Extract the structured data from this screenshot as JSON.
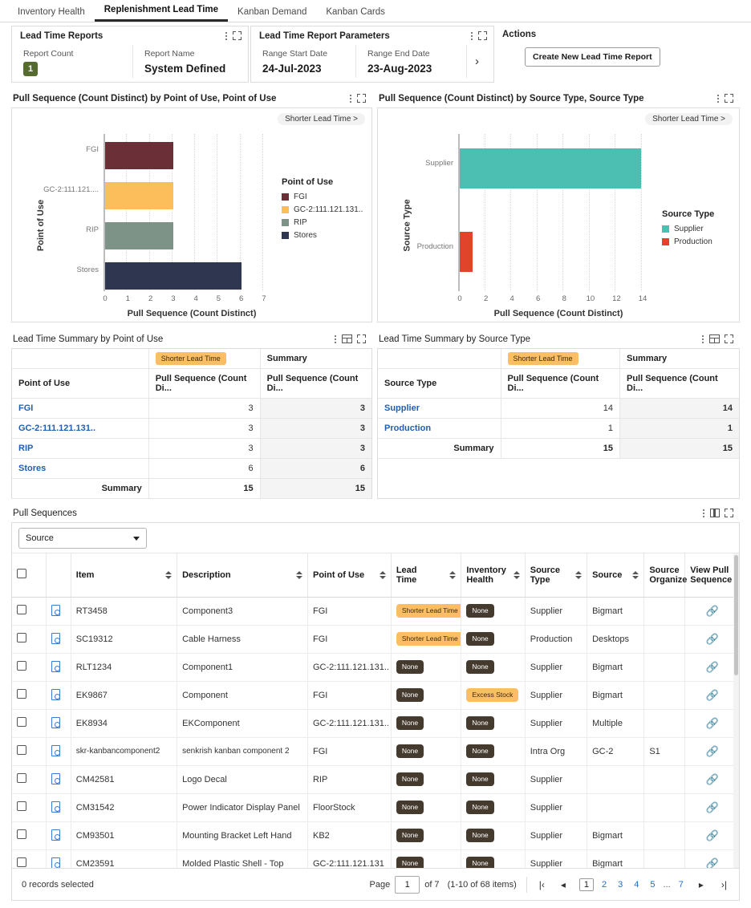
{
  "tabs": [
    {
      "label": "Inventory Health",
      "active": false
    },
    {
      "label": "Replenishment Lead Time",
      "active": true
    },
    {
      "label": "Kanban Demand",
      "active": false
    },
    {
      "label": "Kanban Cards",
      "active": false
    }
  ],
  "reports_panel": {
    "title": "Lead Time Reports",
    "report_count_label": "Report Count",
    "report_count_value": "1",
    "report_name_label": "Report Name",
    "report_name_value": "System Defined"
  },
  "params_panel": {
    "title": "Lead Time Report Parameters",
    "range_start_label": "Range Start Date",
    "range_start_value": "24-Jul-2023",
    "range_end_label": "Range End Date",
    "range_end_value": "23-Aug-2023",
    "next_chevron": "›"
  },
  "actions_panel": {
    "title": "Actions",
    "create_button": "Create New Lead Time Report"
  },
  "chart_left": {
    "title": "Pull Sequence (Count Distinct) by Point of Use, Point of Use",
    "filter_pill": "Shorter Lead Time >",
    "legend_title": "Point of Use",
    "legend": [
      {
        "label": "FGI",
        "color": "#6B2F38"
      },
      {
        "label": "GC-2:111.121.131..",
        "color": "#FBBE5B"
      },
      {
        "label": "RIP",
        "color": "#7E9387"
      },
      {
        "label": "Stores",
        "color": "#2F3650"
      }
    ]
  },
  "chart_right": {
    "title": "Pull Sequence (Count Distinct) by Source Type, Source Type",
    "filter_pill": "Shorter Lead Time >",
    "legend_title": "Source Type",
    "legend": [
      {
        "label": "Supplier",
        "color": "#4DBFB2"
      },
      {
        "label": "Production",
        "color": "#E0442A"
      }
    ]
  },
  "chart_data": [
    {
      "type": "bar",
      "orientation": "horizontal",
      "title": "Pull Sequence (Count Distinct) by Point of Use, Point of Use",
      "categories": [
        "FGI",
        "GC-2:111.121....",
        "RIP",
        "Stores"
      ],
      "values": [
        3,
        3,
        3,
        6
      ],
      "colors": [
        "#6B2F38",
        "#FBBE5B",
        "#7E9387",
        "#2F3650"
      ],
      "xlabel": "Pull Sequence (Count Distinct)",
      "ylabel": "Point of Use",
      "xticks": [
        0,
        1,
        2,
        3,
        4,
        5,
        6,
        7
      ],
      "xlim": [
        0,
        7
      ],
      "grid": true,
      "legend_position": "right",
      "legend_title": "Point of Use",
      "legend_entries": [
        "FGI",
        "GC-2:111.121.131..",
        "RIP",
        "Stores"
      ],
      "annotations": [
        "Shorter Lead Time >"
      ]
    },
    {
      "type": "bar",
      "orientation": "horizontal",
      "title": "Pull Sequence (Count Distinct) by Source Type, Source Type",
      "categories": [
        "Supplier",
        "Production"
      ],
      "values": [
        14,
        1
      ],
      "colors": [
        "#4DBFB2",
        "#E0442A"
      ],
      "xlabel": "Pull Sequence (Count Distinct)",
      "ylabel": "Source Type",
      "xticks": [
        0,
        2,
        4,
        6,
        8,
        10,
        12,
        14
      ],
      "xlim": [
        0,
        14
      ],
      "grid": true,
      "legend_position": "right",
      "legend_title": "Source Type",
      "legend_entries": [
        "Supplier",
        "Production"
      ],
      "annotations": [
        "Shorter Lead Time >"
      ]
    }
  ],
  "summary_left": {
    "title": "Lead Time Summary by Point of Use",
    "tag": "Shorter Lead Time",
    "summary_header": "Summary",
    "col_dim": "Point of Use",
    "col_metric_1": "Pull Sequence (Count Di...",
    "col_metric_2": "Pull Sequence (Count Di...",
    "rows": [
      {
        "dim": "FGI",
        "m1": "3",
        "m2": "3"
      },
      {
        "dim": "GC-2:111.121.131..",
        "m1": "3",
        "m2": "3"
      },
      {
        "dim": "RIP",
        "m1": "3",
        "m2": "3"
      },
      {
        "dim": "Stores",
        "m1": "6",
        "m2": "6"
      }
    ],
    "total_label": "Summary",
    "total_m1": "15",
    "total_m2": "15"
  },
  "summary_right": {
    "title": "Lead Time Summary by Source Type",
    "tag": "Shorter Lead Time",
    "summary_header": "Summary",
    "col_dim": "Source Type",
    "col_metric_1": "Pull Sequence (Count Di...",
    "col_metric_2": "Pull Sequence (Count Di...",
    "rows": [
      {
        "dim": "Supplier",
        "m1": "14",
        "m2": "14"
      },
      {
        "dim": "Production",
        "m1": "1",
        "m2": "1"
      }
    ],
    "total_label": "Summary",
    "total_m1": "15",
    "total_m2": "15"
  },
  "pull_sequences": {
    "title": "Pull Sequences",
    "filter_select_value": "Source",
    "columns": [
      {
        "label": "",
        "sortable": false
      },
      {
        "label": "",
        "sortable": false
      },
      {
        "label": "Item",
        "sortable": true
      },
      {
        "label": "Description",
        "sortable": true
      },
      {
        "label": "Point of Use",
        "sortable": true
      },
      {
        "label": "Lead Time",
        "sortable": true
      },
      {
        "label": "Inventory Health",
        "sortable": true
      },
      {
        "label": "Source Type",
        "sortable": true
      },
      {
        "label": "Source",
        "sortable": true
      },
      {
        "label": "Source Organize",
        "sortable": false
      },
      {
        "label": "View Pull Sequence",
        "sortable": false
      }
    ],
    "rows": [
      {
        "item": "RT3458",
        "description": "Component3",
        "point_of_use": "FGI",
        "lead_time": "Shorter Lead Time",
        "lead_time_style": "amber",
        "inventory_health": "None",
        "inventory_health_style": "none",
        "source_type": "Supplier",
        "source": "Bigmart",
        "source_org": ""
      },
      {
        "item": "SC19312",
        "description": "Cable Harness",
        "point_of_use": "FGI",
        "lead_time": "Shorter Lead Time",
        "lead_time_style": "amber",
        "inventory_health": "None",
        "inventory_health_style": "none",
        "source_type": "Production",
        "source": "Desktops",
        "source_org": ""
      },
      {
        "item": "RLT1234",
        "description": "Component1",
        "point_of_use": "GC-2:111.121.131..",
        "lead_time": "None",
        "lead_time_style": "none",
        "inventory_health": "None",
        "inventory_health_style": "none",
        "source_type": "Supplier",
        "source": "Bigmart",
        "source_org": ""
      },
      {
        "item": "EK9867",
        "description": "Component",
        "point_of_use": "FGI",
        "lead_time": "None",
        "lead_time_style": "none",
        "inventory_health": "Excess Stock",
        "inventory_health_style": "amber",
        "source_type": "Supplier",
        "source": "Bigmart",
        "source_org": ""
      },
      {
        "item": "EK8934",
        "description": "EKComponent",
        "point_of_use": "GC-2:111.121.131..",
        "lead_time": "None",
        "lead_time_style": "none",
        "inventory_health": "None",
        "inventory_health_style": "none",
        "source_type": "Supplier",
        "source": "Multiple",
        "source_org": ""
      },
      {
        "item": "skr-kanbancomponent2",
        "description": "senkrish kanban component 2",
        "point_of_use": "FGI",
        "lead_time": "None",
        "lead_time_style": "none",
        "inventory_health": "None",
        "inventory_health_style": "none",
        "source_type": "Intra Org",
        "source": "GC-2",
        "source_org": "S1"
      },
      {
        "item": "CM42581",
        "description": "Logo Decal",
        "point_of_use": "RIP",
        "lead_time": "None",
        "lead_time_style": "none",
        "inventory_health": "None",
        "inventory_health_style": "none",
        "source_type": "Supplier",
        "source": "",
        "source_org": ""
      },
      {
        "item": "CM31542",
        "description": "Power Indicator Display Panel",
        "point_of_use": "FloorStock",
        "lead_time": "None",
        "lead_time_style": "none",
        "inventory_health": "None",
        "inventory_health_style": "none",
        "source_type": "Supplier",
        "source": "",
        "source_org": ""
      },
      {
        "item": "CM93501",
        "description": "Mounting Bracket Left Hand",
        "point_of_use": "KB2",
        "lead_time": "None",
        "lead_time_style": "none",
        "inventory_health": "None",
        "inventory_health_style": "none",
        "source_type": "Supplier",
        "source": "Bigmart",
        "source_org": ""
      },
      {
        "item": "CM23591",
        "description": "Molded Plastic Shell - Top",
        "point_of_use": "GC-2:111.121.131",
        "lead_time": "None",
        "lead_time_style": "none",
        "inventory_health": "None",
        "inventory_health_style": "none",
        "source_type": "Supplier",
        "source": "Bigmart",
        "source_org": ""
      }
    ]
  },
  "footer": {
    "records_selected": "0 records selected",
    "page_label": "Page",
    "page_value": "1",
    "of_label": "of 7",
    "items_range": "(1-10 of 68 items)",
    "first_icon": "|‹",
    "prev_icon": "◂",
    "next_icon": "▸",
    "last_icon": "›|",
    "pages": [
      "1",
      "2",
      "3",
      "4",
      "5",
      "...",
      "7"
    ],
    "current_page": "1"
  }
}
